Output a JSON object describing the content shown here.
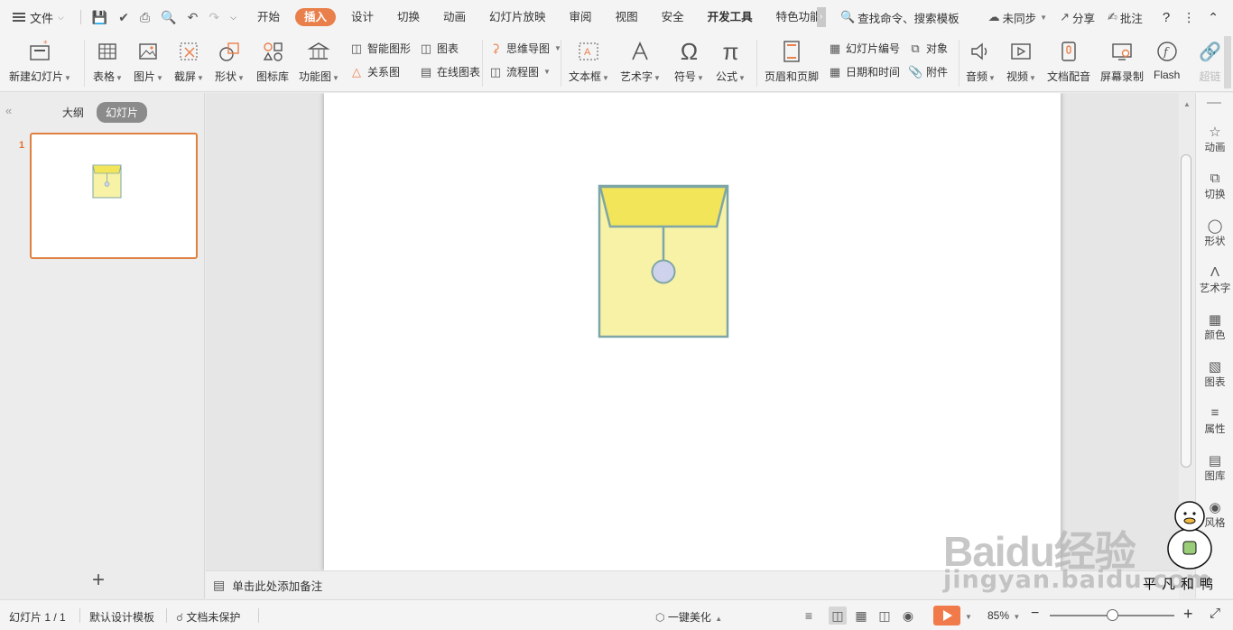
{
  "menubar": {
    "file_label": "文件",
    "tabs": [
      "开始",
      "插入",
      "设计",
      "切换",
      "动画",
      "幻灯片放映",
      "审阅",
      "视图",
      "安全",
      "开发工具",
      "特色功能"
    ],
    "active_tab": "插入",
    "search_label": "查找命令、搜索模板",
    "sync_label": "未同步",
    "share_label": "分享",
    "comment_label": "批注",
    "help_icon": "?"
  },
  "ribbon": {
    "new_slide": "新建幻灯片",
    "table": "表格",
    "picture": "图片",
    "screenshot": "截屏",
    "shape": "形状",
    "icon_lib": "图标库",
    "func_chart": "功能图",
    "smart_art": "智能图形",
    "chart": "图表",
    "relation": "关系图",
    "online_chart": "在线图表",
    "mind_map": "思维导图",
    "flowchart": "流程图",
    "textbox": "文本框",
    "art_text": "艺术字",
    "symbol": "符号",
    "formula": "公式",
    "header_footer": "页眉和页脚",
    "slide_number": "幻灯片编号",
    "object": "对象",
    "date_time": "日期和时间",
    "attachment": "附件",
    "audio": "音频",
    "video": "视频",
    "doc_voice": "文档配音",
    "screen_record": "屏幕录制",
    "flash": "Flash",
    "hyperlink": "超链"
  },
  "leftpanel": {
    "tab_outline": "大纲",
    "tab_slides": "幻灯片",
    "slide_number": "1"
  },
  "notes": {
    "placeholder": "单击此处添加备注"
  },
  "rightbar": {
    "items": [
      "动画",
      "切换",
      "形状",
      "艺术字",
      "颜色",
      "图表",
      "属性",
      "图库",
      "风格"
    ]
  },
  "statusbar": {
    "slide_info": "幻灯片 1 / 1",
    "template": "默认设计模板",
    "protect": "文档未保护",
    "beautify": "一键美化",
    "zoom": "85%",
    "zoom_level": 0.5
  },
  "watermark": {
    "logo_text": "Baidu经验",
    "url": "jingyan.baidu.com",
    "signature": "平凡和鸭"
  },
  "colors": {
    "accent": "#e97f4a",
    "envelope_body": "#f8f2a6",
    "envelope_flap": "#f3e55a",
    "envelope_stroke": "#7fa6a6",
    "button_circle": "#cfd2ec"
  }
}
